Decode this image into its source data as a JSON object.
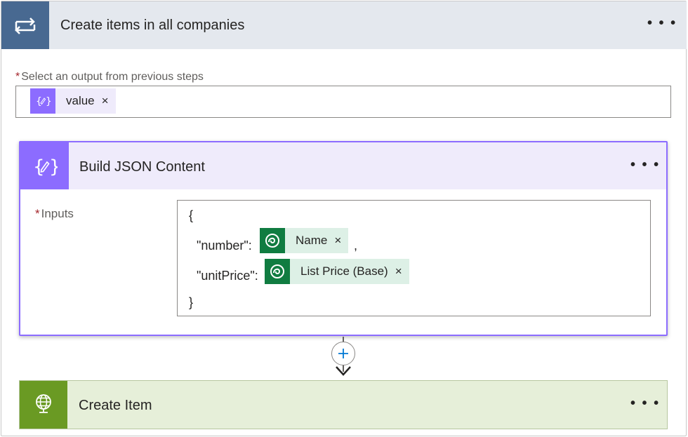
{
  "loop": {
    "title": "Create items in all companies",
    "menu": "• • •",
    "icon": "loop-icon",
    "color": "#486991"
  },
  "select_output": {
    "required_mark": "*",
    "label": "Select an output from previous steps",
    "token": {
      "label": "value",
      "remove": "×",
      "icon": "expression-icon"
    }
  },
  "compose": {
    "title": "Build JSON Content",
    "menu": "• • •",
    "icon": "expression-icon",
    "color": "#8c6cff",
    "inputs_required_mark": "*",
    "inputs_label": "Inputs",
    "code": {
      "open": "{",
      "number_key": "\"number\":",
      "comma": ",",
      "unitprice_key": "\"unitPrice\":",
      "close": "}"
    },
    "tokens": {
      "name": {
        "label": "Name",
        "remove": "×",
        "icon": "dataverse-icon"
      },
      "list_price": {
        "label": "List Price (Base)",
        "remove": "×",
        "icon": "dataverse-icon"
      }
    }
  },
  "add_step": {
    "symbol": "+"
  },
  "create_item": {
    "title": "Create Item",
    "menu": "• • •",
    "icon": "globe-icon",
    "color": "#6a9a23"
  }
}
